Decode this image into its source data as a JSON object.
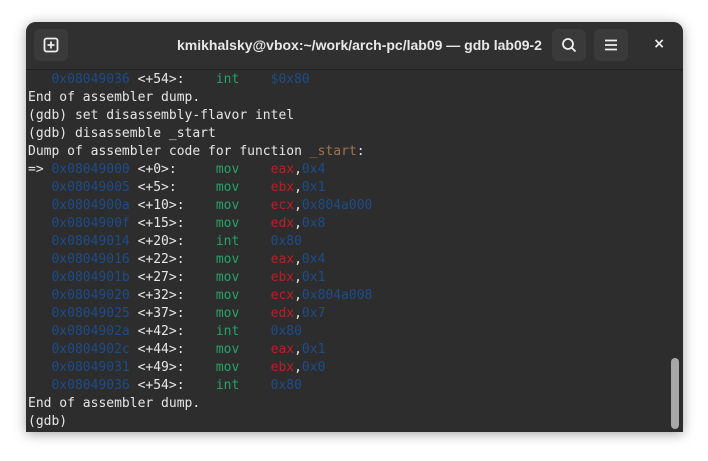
{
  "window": {
    "title": "kmikhalsky@vbox:~/work/arch-pc/lab09 — gdb lab09-2",
    "new_tab_icon": "plus-square-icon",
    "search_icon": "search-icon",
    "menu_icon": "hamburger-icon",
    "close_label": "×"
  },
  "terminal": {
    "top_row": {
      "addr": "0x08049036",
      "off": "<+54>:",
      "op": "int",
      "args": "$0x80"
    },
    "line1": "End of assembler dump.",
    "line2": "(gdb) set disassembly-flavor intel",
    "line3": "(gdb) disassemble _start",
    "line4_prefix": "Dump of assembler code for function ",
    "line4_fn": "_start",
    "line4_suffix": ":",
    "arrow": "=>",
    "rows": [
      {
        "addr": "0x08049000",
        "off": "<+0>:",
        "op": "mov",
        "reg": "eax",
        "val": "0x4"
      },
      {
        "addr": "0x08049005",
        "off": "<+5>:",
        "op": "mov",
        "reg": "ebx",
        "val": "0x1"
      },
      {
        "addr": "0x0804900a",
        "off": "<+10>:",
        "op": "mov",
        "reg": "ecx",
        "val": "0x804a000"
      },
      {
        "addr": "0x0804900f",
        "off": "<+15>:",
        "op": "mov",
        "reg": "edx",
        "val": "0x8"
      },
      {
        "addr": "0x08049014",
        "off": "<+20>:",
        "op": "int",
        "reg": "",
        "val": "0x80"
      },
      {
        "addr": "0x08049016",
        "off": "<+22>:",
        "op": "mov",
        "reg": "eax",
        "val": "0x4"
      },
      {
        "addr": "0x0804901b",
        "off": "<+27>:",
        "op": "mov",
        "reg": "ebx",
        "val": "0x1"
      },
      {
        "addr": "0x08049020",
        "off": "<+32>:",
        "op": "mov",
        "reg": "ecx",
        "val": "0x804a008"
      },
      {
        "addr": "0x08049025",
        "off": "<+37>:",
        "op": "mov",
        "reg": "edx",
        "val": "0x7"
      },
      {
        "addr": "0x0804902a",
        "off": "<+42>:",
        "op": "int",
        "reg": "",
        "val": "0x80"
      },
      {
        "addr": "0x0804902c",
        "off": "<+44>:",
        "op": "mov",
        "reg": "eax",
        "val": "0x1"
      },
      {
        "addr": "0x08049031",
        "off": "<+49>:",
        "op": "mov",
        "reg": "ebx",
        "val": "0x0"
      },
      {
        "addr": "0x08049036",
        "off": "<+54>:",
        "op": "int",
        "reg": "",
        "val": "0x80"
      }
    ],
    "end_line": "End of assembler dump.",
    "prompt": "(gdb)"
  }
}
